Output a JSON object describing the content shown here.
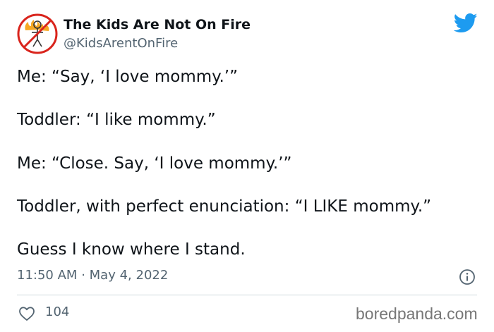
{
  "author": {
    "display_name": "The Kids Are Not On Fire",
    "handle": "@KidsArentOnFire",
    "avatar_icon": "no-fire-stick-figure-icon"
  },
  "brand": {
    "logo_icon": "twitter-bird-icon",
    "accent_color": "#1d9bf0"
  },
  "tweet": {
    "lines": [
      "Me: “Say, ‘I love mommy.’”",
      "Toddler: “I like mommy.”",
      "Me: “Close. Say, ‘I love mommy.’”",
      "Toddler, with perfect enunciation: “I LIKE mommy.”",
      "Guess I know where I stand."
    ],
    "time": "11:50 AM",
    "separator": "·",
    "date": "May 4, 2022"
  },
  "actions": {
    "like_icon": "heart-icon",
    "like_count": "104",
    "info_icon": "info-icon"
  },
  "watermark": "boredpanda.com"
}
